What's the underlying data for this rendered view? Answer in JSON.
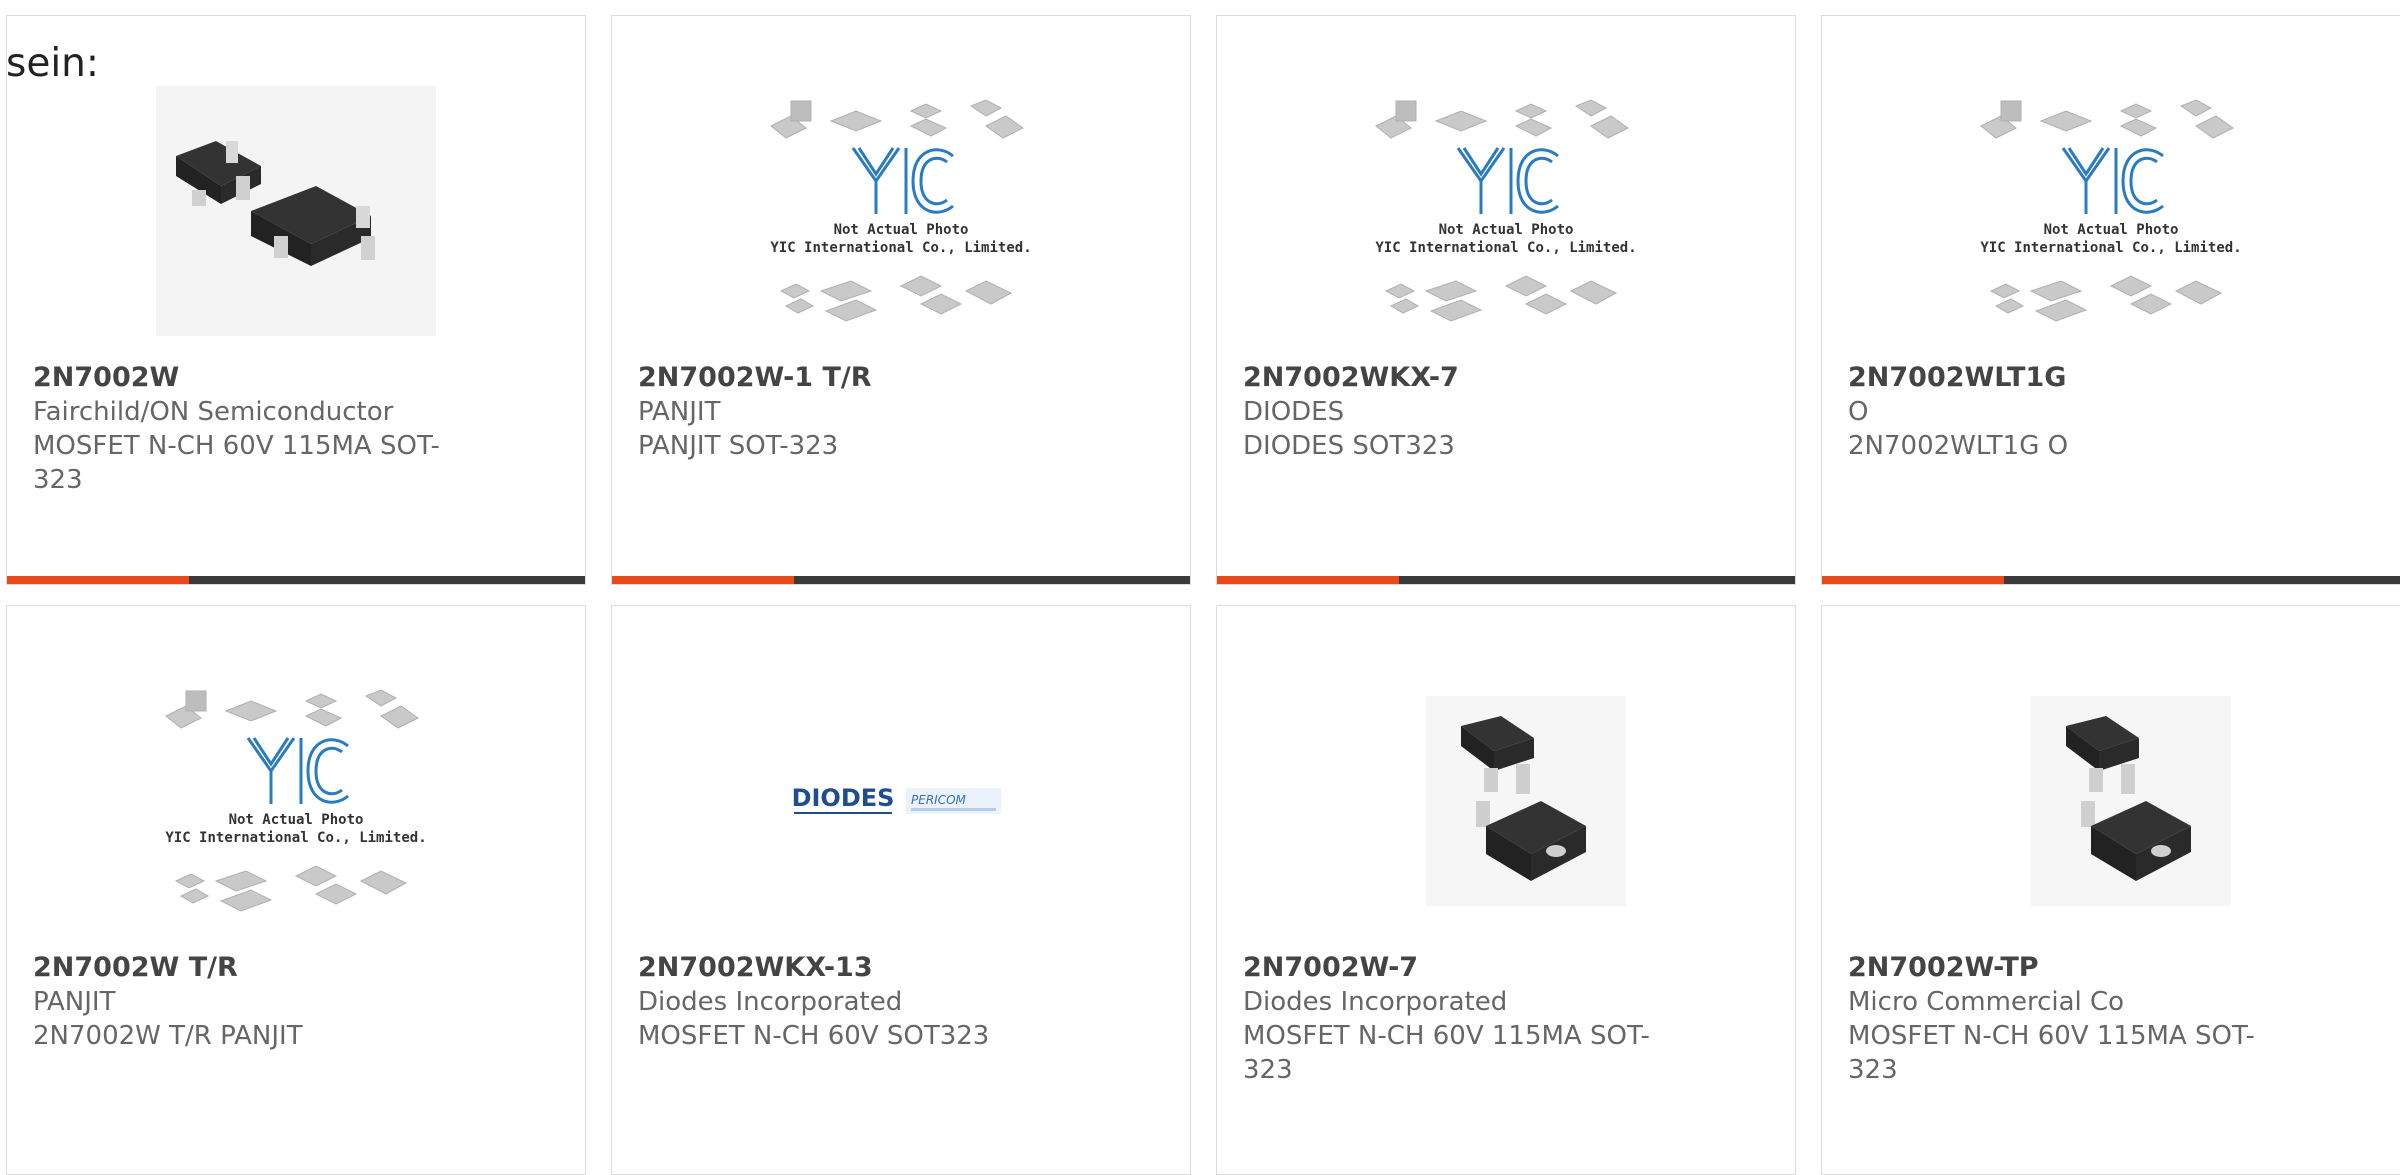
{
  "heading": "sein:",
  "watermark": {
    "brand": "YIC",
    "line1": "Not Actual Photo",
    "line2": "YIC International Co., Limited."
  },
  "logos": {
    "diodes": "DIODES",
    "pericom": "PERICOM"
  },
  "colors": {
    "accent": "#e84a1c",
    "bar": "#3a3a3a",
    "yic_blue": "#2a7bbf"
  },
  "products": [
    {
      "part": "2N7002W",
      "manufacturer": "Fairchild/ON Semiconductor",
      "description": "MOSFET N-CH 60V 115MA SOT-323",
      "image": "sot323-photo"
    },
    {
      "part": "2N7002W-1 T/R",
      "manufacturer": "PANJIT",
      "description": "PANJIT SOT-323",
      "image": "yic-placeholder"
    },
    {
      "part": "2N7002WKX-7",
      "manufacturer": "DIODES",
      "description": "DIODES SOT323",
      "image": "yic-placeholder"
    },
    {
      "part": "2N7002WLT1G",
      "manufacturer": "O",
      "description": "2N7002WLT1G O",
      "image": "yic-placeholder"
    },
    {
      "part": "2N7002W T/R",
      "manufacturer": "PANJIT",
      "description": "2N7002W T/R PANJIT",
      "image": "yic-placeholder"
    },
    {
      "part": "2N7002WKX-13",
      "manufacturer": "Diodes Incorporated",
      "description": "MOSFET N-CH 60V SOT323",
      "image": "diodes-logo"
    },
    {
      "part": "2N7002W-7",
      "manufacturer": "Diodes Incorporated",
      "description": "MOSFET N-CH 60V 115MA SOT-323",
      "image": "sot323-single"
    },
    {
      "part": "2N7002W-TP",
      "manufacturer": "Micro Commercial Co",
      "description": "MOSFET N-CH 60V 115MA SOT-323",
      "image": "sot323-single"
    }
  ]
}
